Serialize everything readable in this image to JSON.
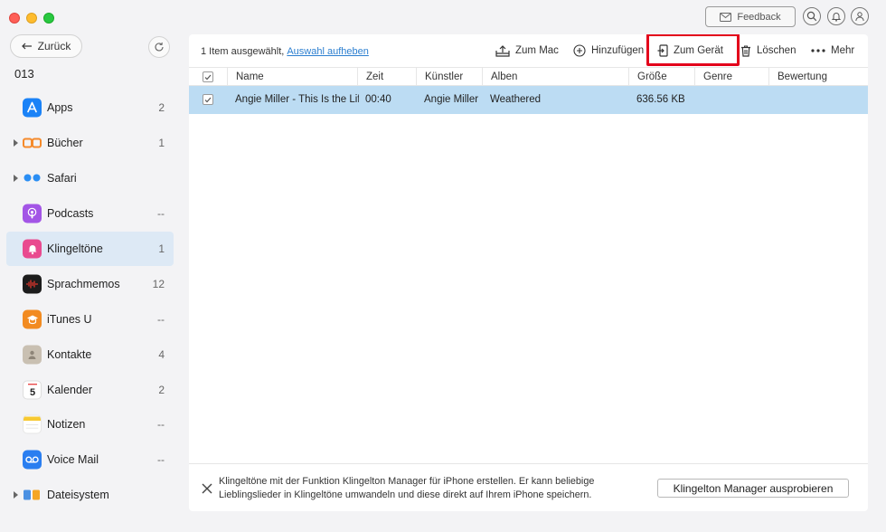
{
  "header": {
    "feedback_label": "Feedback"
  },
  "sidebar": {
    "back_label": "Zurück",
    "device_name": "013",
    "items": [
      {
        "label": "Apps",
        "count": "2",
        "icon": "apps-icon",
        "color": "#1a82f7",
        "caret": false
      },
      {
        "label": "Bücher",
        "count": "1",
        "icon": "books-icon",
        "color": "#f58a2b",
        "caret": true
      },
      {
        "label": "Safari",
        "count": "",
        "icon": "safari-icon",
        "color": "#2a8ef4",
        "caret": true
      },
      {
        "label": "Podcasts",
        "count": "--",
        "icon": "podcasts-icon",
        "color": "#a355e6",
        "caret": false
      },
      {
        "label": "Klingeltöne",
        "count": "1",
        "icon": "ringtone-bell-icon",
        "color": "#e94a8f",
        "caret": false,
        "active": true
      },
      {
        "label": "Sprachmemos",
        "count": "12",
        "icon": "voice-memo-icon",
        "color": "#1c1c1c",
        "caret": false
      },
      {
        "label": "iTunes U",
        "count": "--",
        "icon": "itunes-u-icon",
        "color": "#f28b21",
        "caret": false
      },
      {
        "label": "Kontakte",
        "count": "4",
        "icon": "contacts-icon",
        "color": "#c9c0b2",
        "caret": false
      },
      {
        "label": "Kalender",
        "count": "2",
        "icon": "calendar-icon",
        "color": "#ffffff",
        "caret": false
      },
      {
        "label": "Notizen",
        "count": "--",
        "icon": "notes-icon",
        "color": "#f7c932",
        "caret": false
      },
      {
        "label": "Voice Mail",
        "count": "--",
        "icon": "voicemail-icon",
        "color": "#2a7ef0",
        "caret": false
      },
      {
        "label": "Dateisystem",
        "count": "",
        "icon": "filesystem-icon",
        "color": "#4a90e2",
        "caret": true
      }
    ]
  },
  "main": {
    "selection_text": "1 Item ausgewählt,",
    "deselect_link": "Auswahl aufheben",
    "toolbar": {
      "to_mac": "Zum Mac",
      "add": "Hinzufügen",
      "to_device": "Zum Gerät",
      "delete": "Löschen",
      "more": "Mehr"
    },
    "columns": [
      "Name",
      "Zeit",
      "Künstler",
      "Alben",
      "Größe",
      "Genre",
      "Bewertung"
    ],
    "rows": [
      {
        "name": "Angie Miller - This Is the Life",
        "time": "00:40",
        "artist": "Angie Miller",
        "album": "Weathered",
        "size": "636.56 KB",
        "genre": "",
        "rating": ""
      }
    ],
    "footer": {
      "text": "Klingeltöne mit der Funktion Klingelton Manager für iPhone erstellen. Er kann beliebige Lieblingslieder in Klingeltöne umwandeln und diese direkt auf Ihrem iPhone speichern.",
      "button_label": "Klingelton Manager ausprobieren"
    }
  },
  "colors": {
    "accent": "#2c7fd0",
    "selected_row": "#bcdcf3",
    "highlight": "#e3001b"
  }
}
